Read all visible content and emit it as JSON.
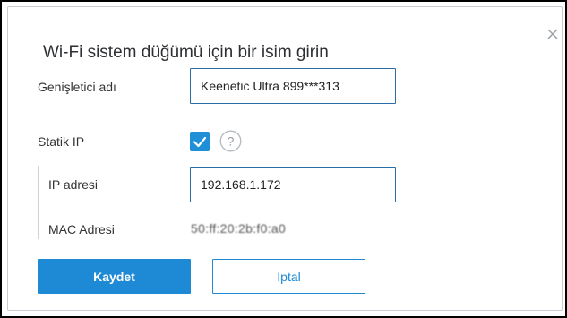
{
  "dialog": {
    "title": "Wi-Fi sistem düğümü için bir isim girin",
    "close_icon": "close-icon"
  },
  "fields": {
    "extender_name_label": "Genişletici adı",
    "extender_name_value": "Keenetic Ultra 899***313",
    "static_ip_label": "Statik IP",
    "static_ip_checked": true,
    "help_icon": "question-circle-icon",
    "ip_label": "IP adresi",
    "ip_value": "192.168.1.172",
    "mac_label": "MAC Adresi",
    "mac_value": "50:ff:20:2b:f0:a0"
  },
  "actions": {
    "save_label": "Kaydet",
    "cancel_label": "İptal"
  },
  "colors": {
    "accent": "#1e8ad6",
    "input_border": "#2b6ea7",
    "text": "#333333"
  }
}
